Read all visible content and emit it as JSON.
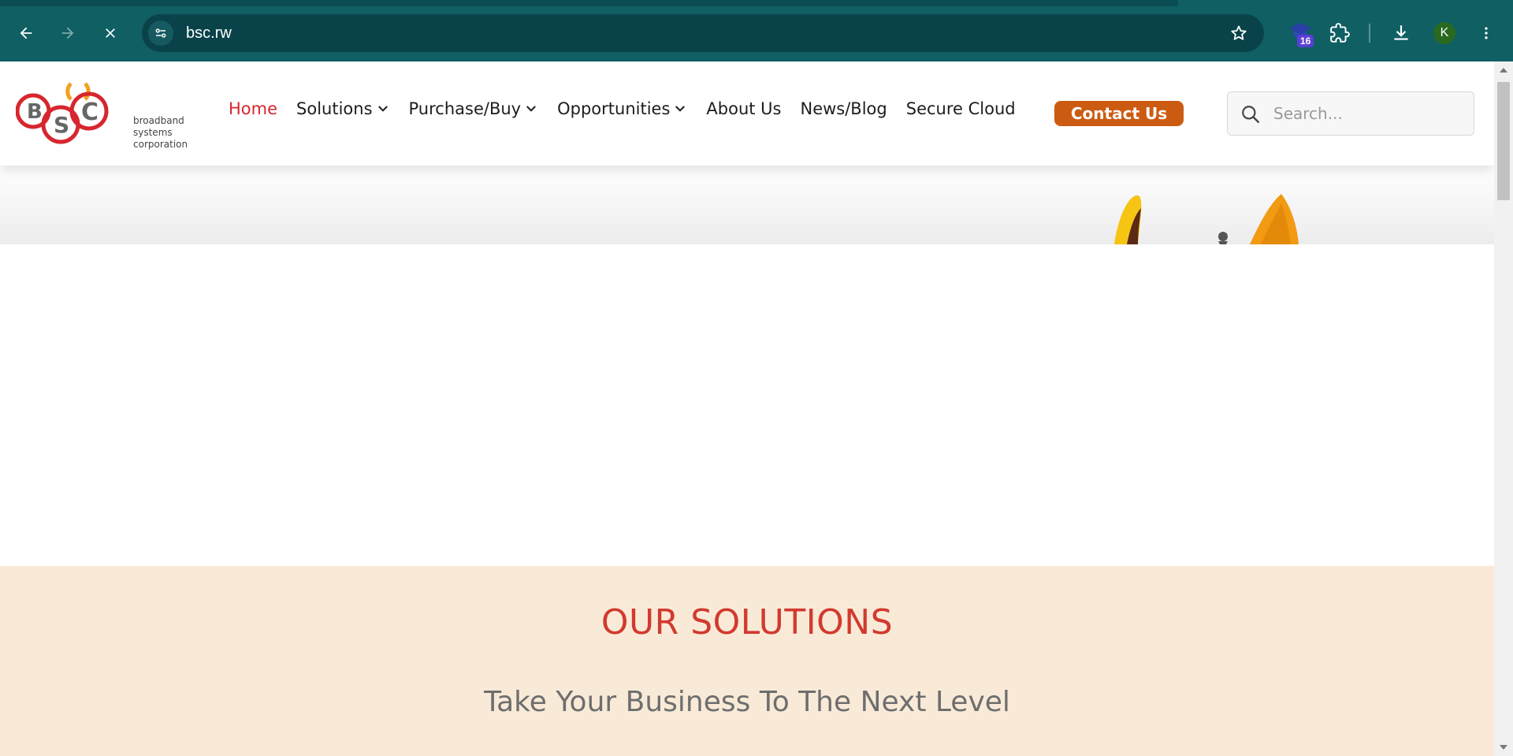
{
  "browser": {
    "url": "bsc.rw",
    "extension_badge_count": "16",
    "profile_initial": "K",
    "icons": {
      "back": "arrow-left-icon",
      "forward": "arrow-right-icon",
      "stop": "close-icon",
      "site_info": "tune-icon",
      "bookmark": "star-icon",
      "extensions": "puzzle-icon",
      "downloads": "download-icon",
      "menu": "kebab-menu-icon"
    }
  },
  "site": {
    "logo_text_line1": "broadband",
    "logo_text_line2": "systems",
    "logo_text_line3": "corporation",
    "nav": {
      "home": "Home",
      "solutions": "Solutions",
      "purchase": "Purchase/Buy",
      "opportunities": "Opportunities",
      "about": "About Us",
      "news": "News/Blog",
      "cloud": "Secure Cloud"
    },
    "contact_label": "Contact Us",
    "search_placeholder": "Search...",
    "colors": {
      "accent_red": "#d7262e",
      "contact_orange": "#cc5b12",
      "chrome_teal": "#0f5f63",
      "section_bg": "#f9ead8"
    }
  },
  "solutions": {
    "heading": "OUR SOLUTIONS",
    "subheading": "Take Your Business To The Next Level"
  }
}
